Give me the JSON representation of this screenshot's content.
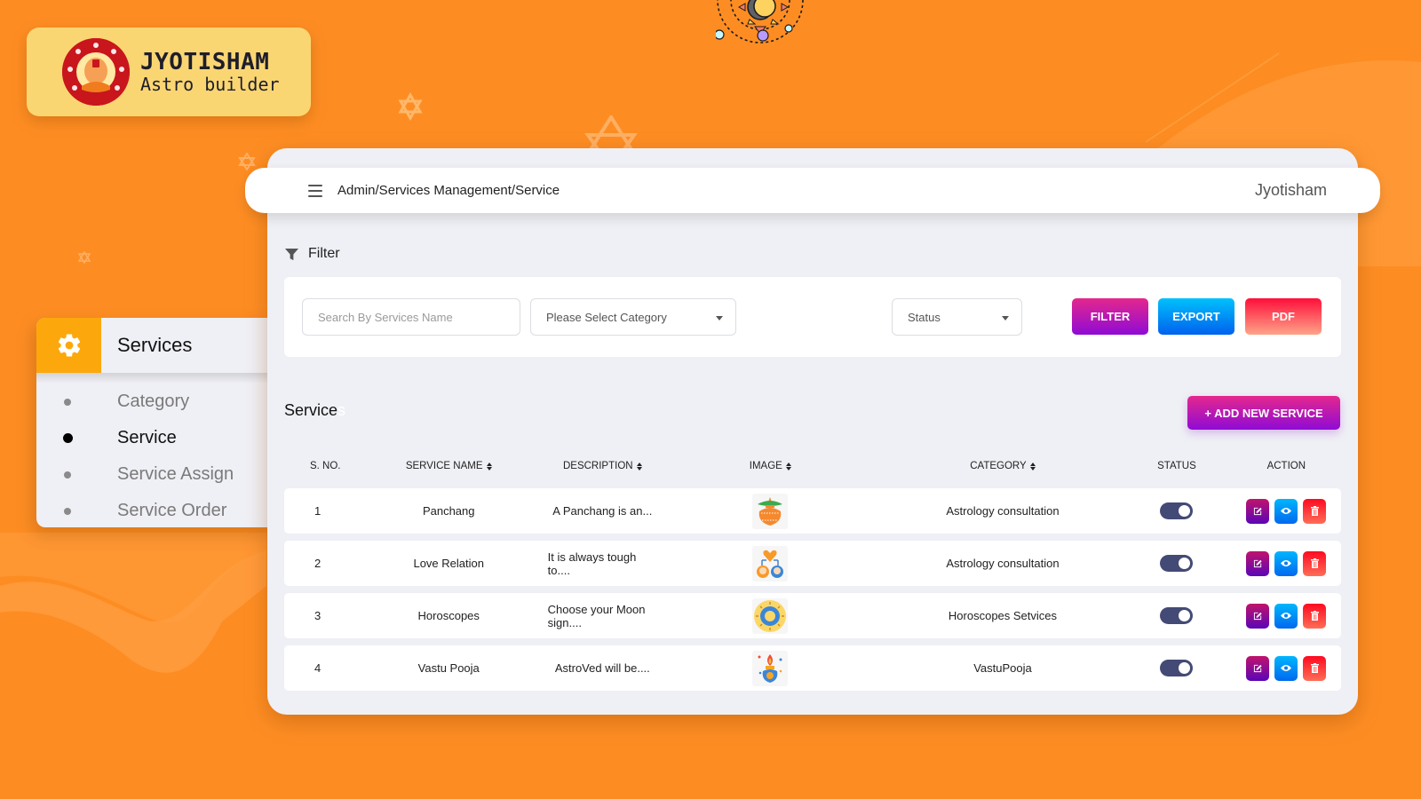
{
  "brand": {
    "title": "JYOTISHAM",
    "subtitle": "Astro builder"
  },
  "sidebar": {
    "section_label": "Services",
    "section_icon": "gear-icon",
    "items": [
      {
        "label": "Category",
        "active": false
      },
      {
        "label": "Service",
        "active": true
      },
      {
        "label": "Service Assign",
        "active": false
      },
      {
        "label": "Service Order",
        "active": false
      }
    ]
  },
  "topbar": {
    "menu_icon": "hamburger-icon",
    "breadcrumb": "Admin/Services Management/Service",
    "user_name": "Jyotisham"
  },
  "filter": {
    "heading": "Filter",
    "heading_icon": "funnel-icon",
    "search_placeholder": "Search By Services Name",
    "search_value": "",
    "category_select": "Please Select Category",
    "status_select": "Status",
    "filter_button": "FILTER",
    "export_button": "EXPORT",
    "pdf_button": "PDF"
  },
  "services": {
    "title": "Service",
    "title_faded_suffix": "s",
    "add_button": "+  ADD NEW SERVICE",
    "columns": {
      "sno": "S. NO.",
      "name": "SERVICE NAME",
      "description": "DESCRIPTION",
      "image": "IMAGE",
      "category": "CATEGORY",
      "status": "STATUS",
      "action": "ACTION"
    },
    "rows": [
      {
        "sno": "1",
        "name": "Panchang",
        "description": "A Panchang is an...",
        "image": "kalash-pot-image",
        "category": "Astrology consultation",
        "status": true
      },
      {
        "sno": "2",
        "name": "Love Relation",
        "description": "It is always tough to....",
        "image": "couple-heart-image",
        "category": "Astrology consultation",
        "status": true
      },
      {
        "sno": "3",
        "name": "Horoscopes",
        "description": "Choose your Moon sign....",
        "image": "zodiac-wheel-image",
        "category": "Horoscopes Setvices",
        "status": true
      },
      {
        "sno": "4",
        "name": "Vastu Pooja",
        "description": "AstroVed will be....",
        "image": "pooja-kalash-image",
        "category": "VastuPooja",
        "status": true
      }
    ]
  },
  "colors": {
    "background": "#fd8d23",
    "logo_card": "#fad673",
    "sidebar_accent": "#fca80c",
    "toggle_on": "#434a75",
    "filter_gradient": [
      "#e4278d",
      "#8f0bd5"
    ],
    "export_gradient": [
      "#00c1fc",
      "#0061ee"
    ],
    "pdf_gradient": [
      "#ff0e39",
      "#ffa489"
    ]
  }
}
